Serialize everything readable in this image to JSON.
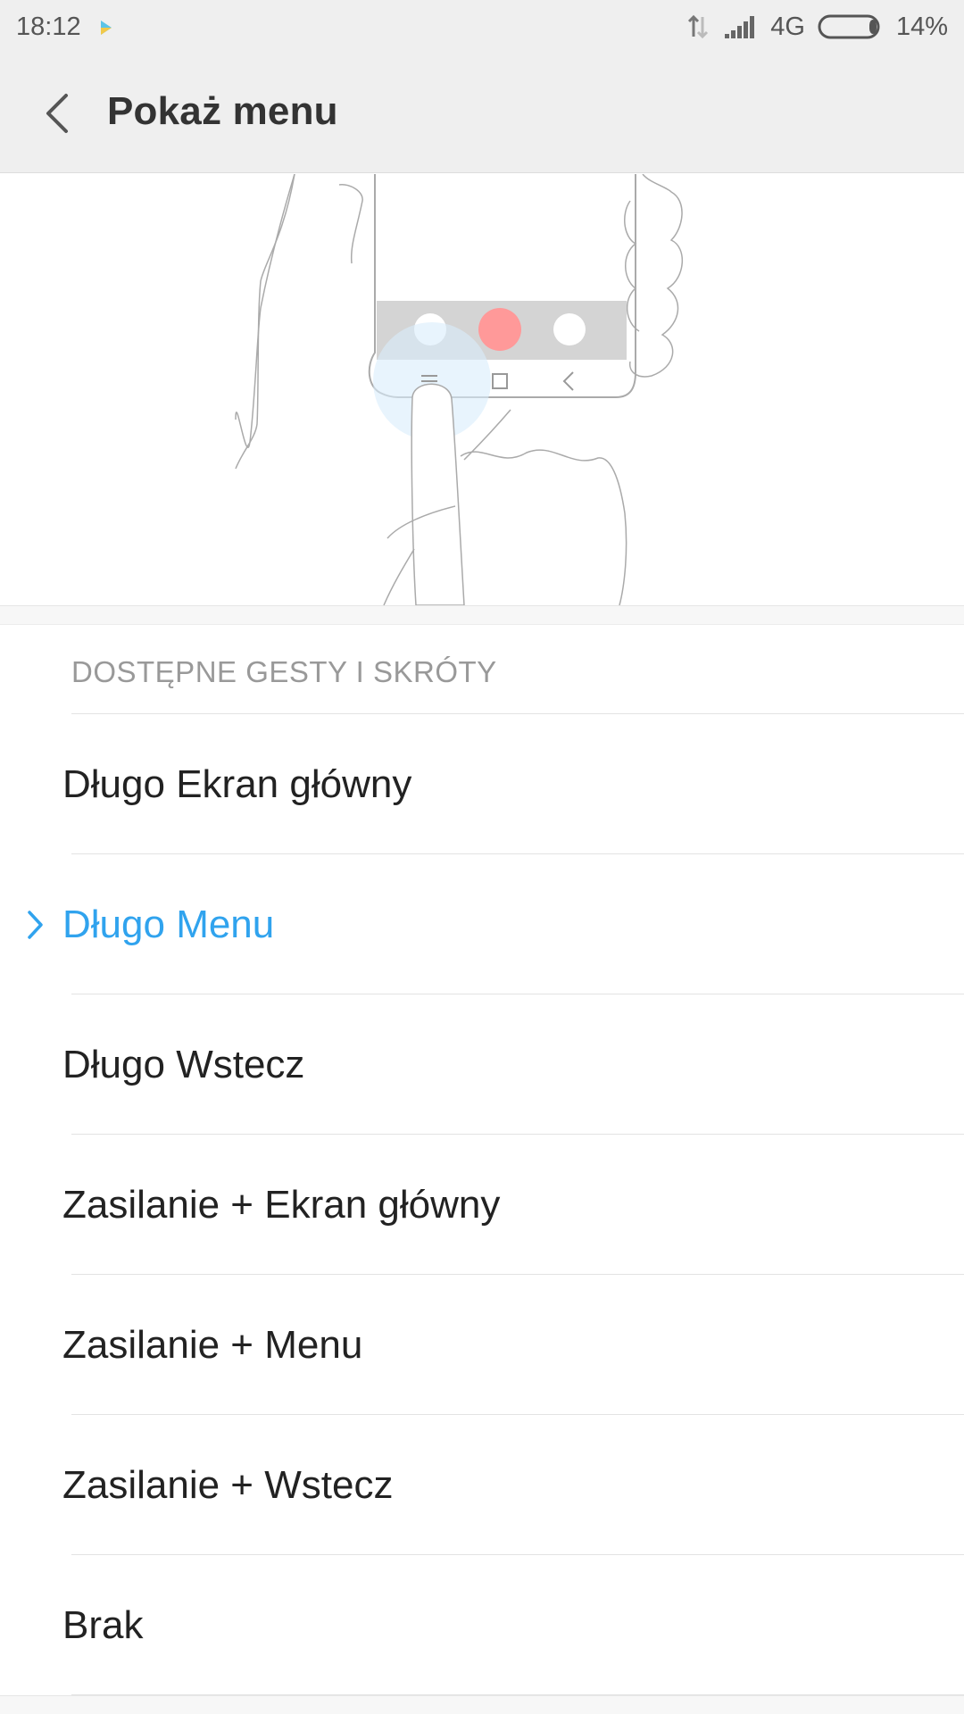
{
  "status_bar": {
    "time": "18:12",
    "network": "4G",
    "battery": "14%",
    "battery_level": 0.14,
    "icons": [
      "play-notification-icon",
      "data-transfer-icon",
      "signal-icon",
      "battery-icon"
    ]
  },
  "header": {
    "title": "Pokaż menu",
    "back_icon": "chevron-left-icon"
  },
  "illustration": {
    "highlight_color": "#ff9999",
    "touch_color": "#d9ecfb",
    "icon": "phone-menu-gesture-illustration"
  },
  "section": {
    "header": "DOSTĘPNE GESTY I SKRÓTY"
  },
  "options": [
    {
      "label": "Długo Ekran główny",
      "selected": false
    },
    {
      "label": "Długo Menu",
      "selected": true
    },
    {
      "label": "Długo Wstecz",
      "selected": false
    },
    {
      "label": "Zasilanie + Ekran główny",
      "selected": false
    },
    {
      "label": "Zasilanie + Menu",
      "selected": false
    },
    {
      "label": "Zasilanie + Wstecz",
      "selected": false
    },
    {
      "label": "Brak",
      "selected": false
    }
  ],
  "colors": {
    "accent": "#30a3ee",
    "background": "#ffffff",
    "bar": "#efefef"
  }
}
